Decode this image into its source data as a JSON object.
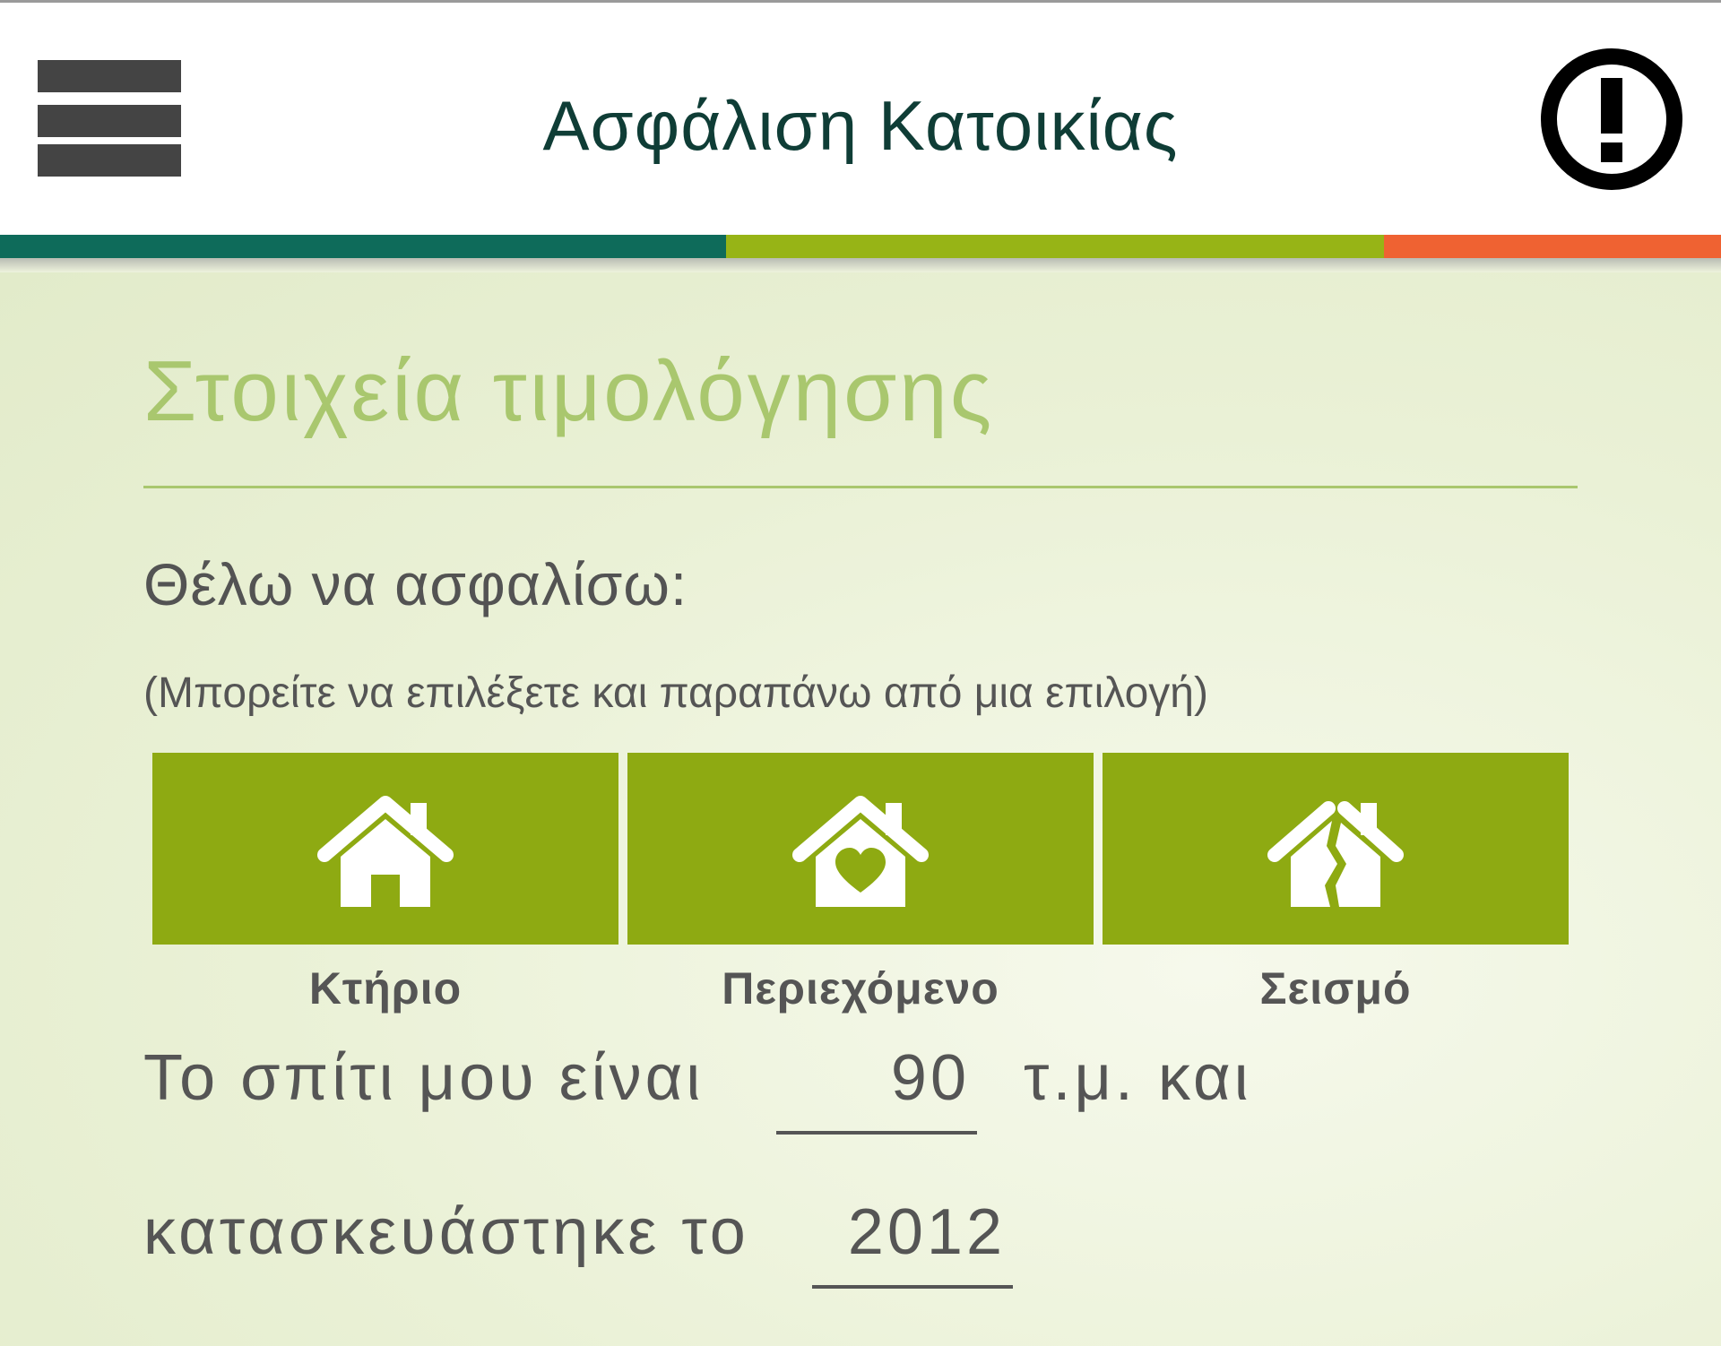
{
  "header": {
    "title": "Ασφάλιση Κατοικίας",
    "menu_icon": "hamburger-menu-icon",
    "alert_icon": "exclamation-circle-icon",
    "strip_colors": [
      "#0e6b5a",
      "#97b416",
      "#ef6232"
    ]
  },
  "section": {
    "title": "Στοιχεία τιμολόγησης",
    "question": "Θέλω να ασφαλίσω:",
    "hint": "(Μπορείτε να επιλέξετε και παραπάνω από μια επιλογή)"
  },
  "options": [
    {
      "label": "Κτήριο",
      "icon": "house-icon"
    },
    {
      "label": "Περιεχόμενο",
      "icon": "house-heart-icon"
    },
    {
      "label": "Σεισμό",
      "icon": "house-cracked-icon"
    }
  ],
  "form": {
    "line1_prefix": "Το σπίτι μου είναι",
    "area_value": "90",
    "line1_suffix": "τ.μ. και",
    "line2_prefix": "κατασκευάστηκε το",
    "year_value": "2012"
  },
  "colors": {
    "accent_green": "#8eaa12",
    "title_green": "#a9c76e",
    "header_text": "#0f3d36"
  }
}
